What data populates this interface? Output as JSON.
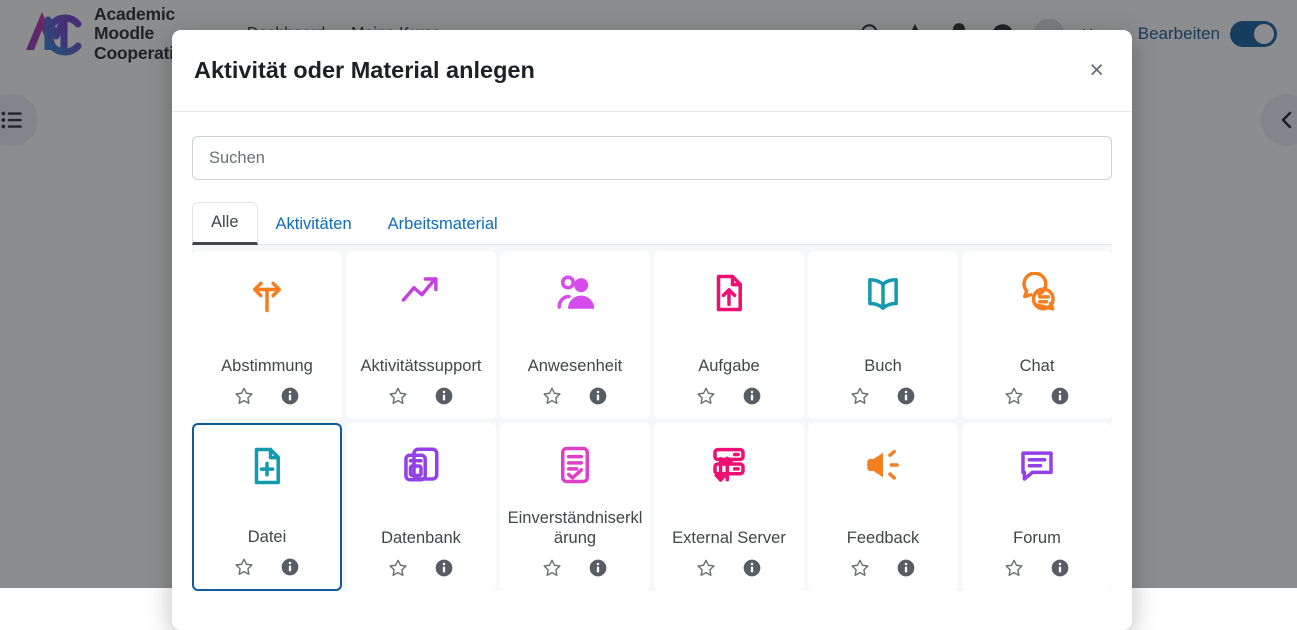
{
  "brand": {
    "logo_icon": "amc-logo-icon",
    "name_line1": "Academic",
    "name_line2": "Moodle",
    "name_line3": "Cooperation"
  },
  "topnav": {
    "links": [
      "Dashboard",
      "Meine Kurse"
    ],
    "icons": [
      "search-icon",
      "star-icon",
      "notification-bell-icon",
      "messages-icon"
    ],
    "user_name": "User",
    "edit_toggle_label": "Bearbeiten",
    "edit_toggle_on": true,
    "accent_color": "#0f5a9c"
  },
  "page": {
    "drawer_left_icon": "list-menu-icon",
    "drawer_right_icon": "chevron-left-icon"
  },
  "modal": {
    "title": "Aktivität oder Material anlegen",
    "close_label": "×",
    "search": {
      "value": "",
      "placeholder": "Suchen"
    },
    "tabs": [
      {
        "label": "Alle",
        "active": true
      },
      {
        "label": "Aktivitäten",
        "active": false
      },
      {
        "label": "Arbeitsmaterial",
        "active": false
      }
    ],
    "star_icon": "star-outline-icon",
    "info_icon": "info-circle-icon",
    "items": [
      {
        "label": "Abstimmung",
        "icon": "fork-arrows-icon",
        "color": "#f47f20",
        "selected": false
      },
      {
        "label": "Aktivitätssupport",
        "icon": "trend-arrow-icon",
        "color": "#c640e0",
        "selected": false
      },
      {
        "label": "Anwesenheit",
        "icon": "people-group-icon",
        "color": "#d64bec",
        "selected": false
      },
      {
        "label": "Aufgabe",
        "icon": "upload-document-icon",
        "color": "#ec0f74",
        "selected": false
      },
      {
        "label": "Buch",
        "icon": "open-book-icon",
        "color": "#139ab0",
        "selected": false
      },
      {
        "label": "Chat",
        "icon": "speech-bubbles-icon",
        "color": "#f47f20",
        "selected": false
      },
      {
        "label": "Datei",
        "icon": "file-plus-icon",
        "color": "#139ab0",
        "selected": true
      },
      {
        "label": "Datenbank",
        "icon": "database-stack-icon",
        "color": "#9240e8",
        "selected": false
      },
      {
        "label": "Einverständniserklärung",
        "icon": "checklist-doc-icon",
        "color": "#e040c8",
        "selected": false
      },
      {
        "label": "External Server",
        "icon": "server-transfer-icon",
        "color": "#ec0f74",
        "selected": false
      },
      {
        "label": "Feedback",
        "icon": "megaphone-icon",
        "color": "#f47f20",
        "selected": false
      },
      {
        "label": "Forum",
        "icon": "speech-lines-icon",
        "color": "#9240e8",
        "selected": false
      }
    ]
  }
}
